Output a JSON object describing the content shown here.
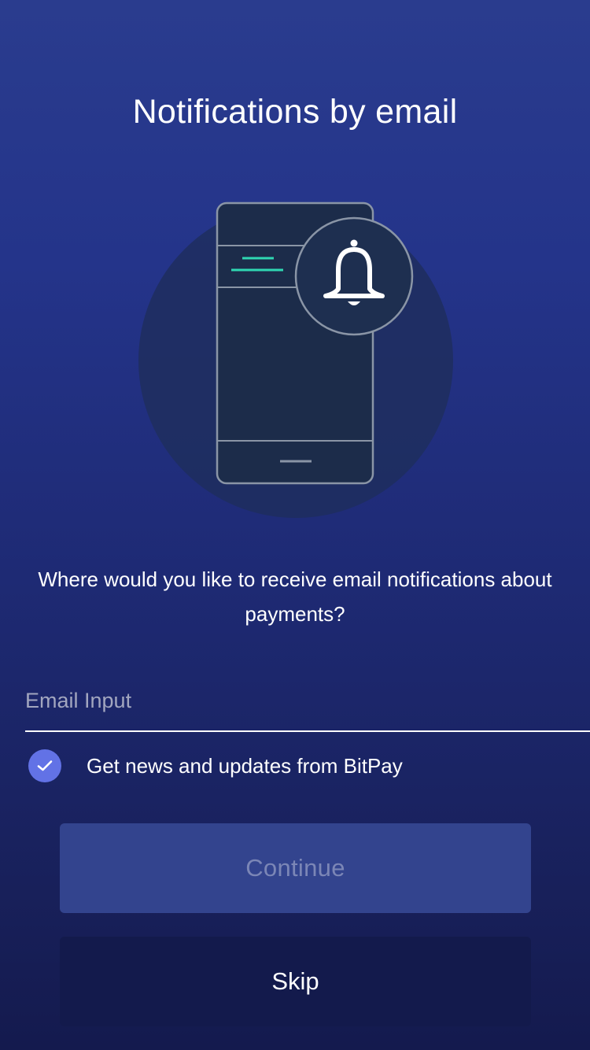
{
  "header": {
    "title": "Notifications by email"
  },
  "illustration": {
    "icons": [
      "phone-icon",
      "bell-icon"
    ],
    "accent_color": "#2fd7b2"
  },
  "main": {
    "question": "Where would you like to receive email notifications about payments?",
    "email": {
      "placeholder": "Email Input",
      "value": ""
    },
    "news_checkbox": {
      "label": "Get news and updates from BitPay",
      "checked": true
    }
  },
  "actions": {
    "continue_label": "Continue",
    "skip_label": "Skip"
  },
  "colors": {
    "background_top": "#2a3c8e",
    "background_bottom": "#141a4e",
    "checkbox": "#6272e6",
    "continue_button": "#33448e",
    "skip_button": "#131a4c"
  }
}
